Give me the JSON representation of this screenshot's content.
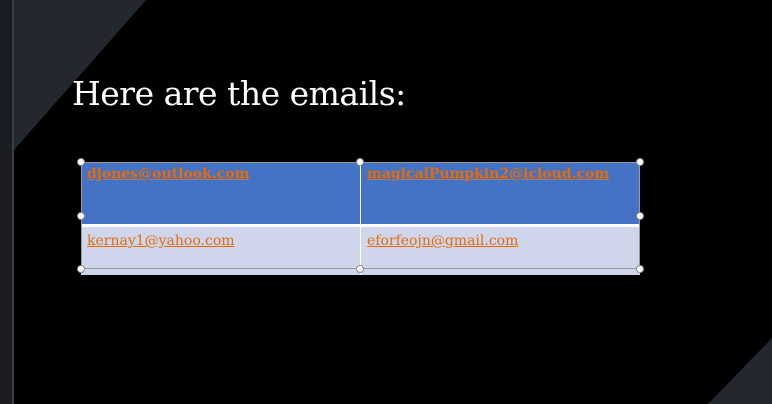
{
  "slide": {
    "title": "Here are the emails:",
    "colors": {
      "background": "#000000",
      "header_fill": "#4472c4",
      "row_fill": "#cfd5ea",
      "link": "#e46c0a"
    }
  },
  "table": {
    "rows": [
      [
        "djones@outlook.com",
        "magicalPumpkin2@icloud.com"
      ],
      [
        "kernay1@yahoo.com",
        "eforfeojn@gmail.com"
      ]
    ]
  },
  "selection": {
    "handle_icon": "resize-handle-icon"
  }
}
